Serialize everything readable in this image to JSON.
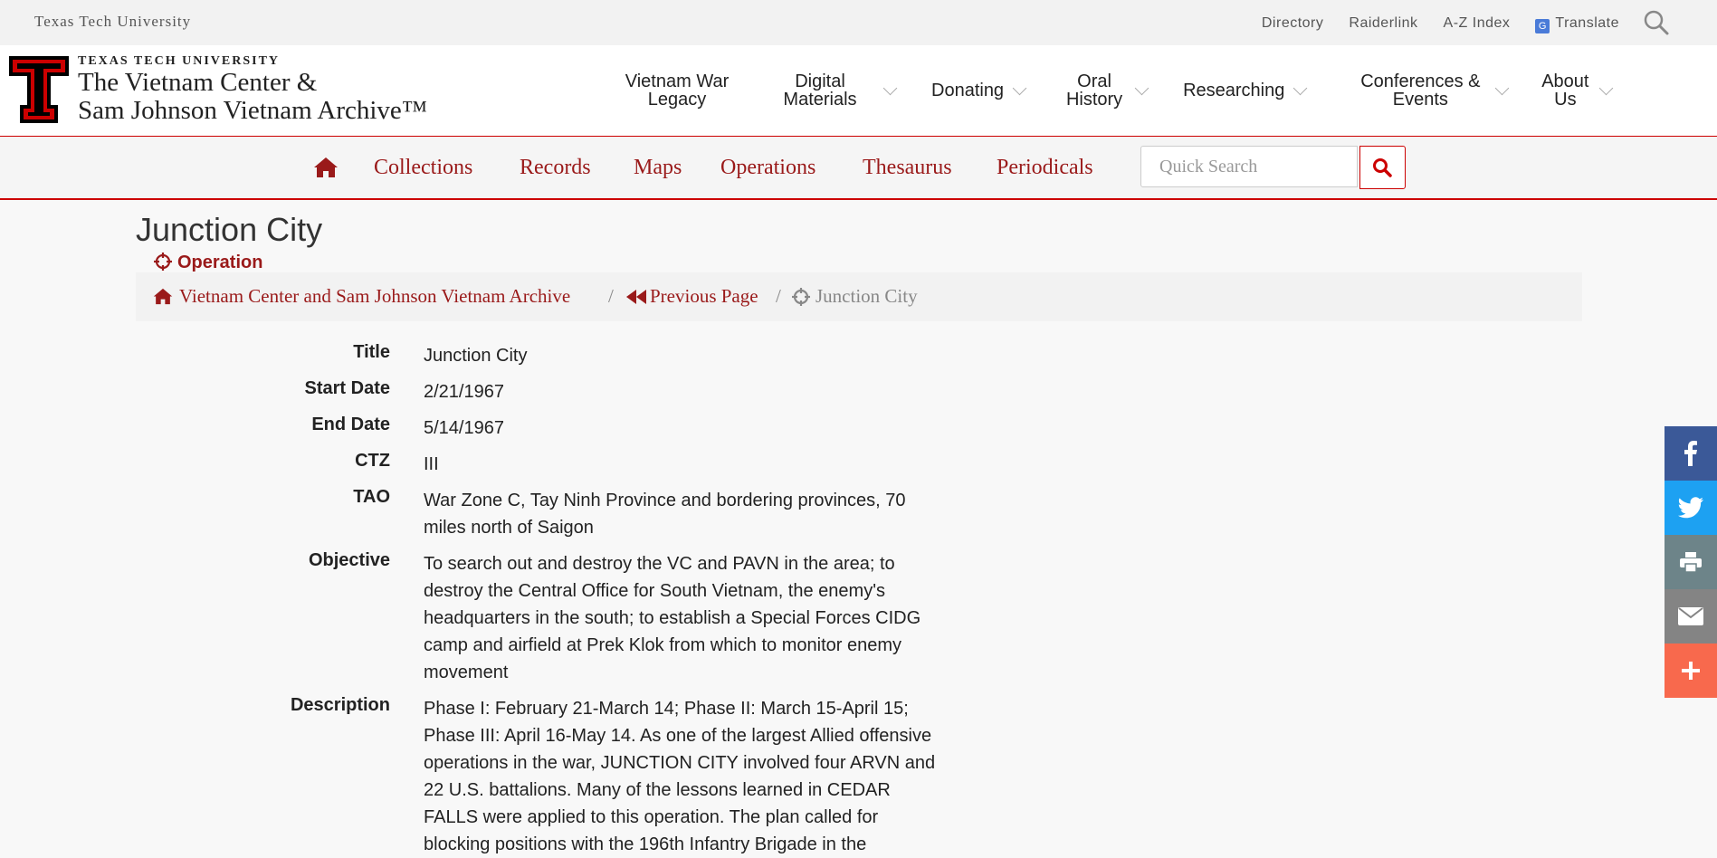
{
  "utility": {
    "university": "Texas Tech University",
    "links": [
      "Directory",
      "Raiderlink",
      "A-Z Index",
      "Translate"
    ]
  },
  "logo": {
    "line1": "TEXAS TECH UNIVERSITY",
    "line2": "The Vietnam Center &",
    "line3": "Sam Johnson Vietnam Archive™"
  },
  "mainnav": [
    {
      "line1": "Vietnam War",
      "line2": "Legacy"
    },
    {
      "line1": "Digital",
      "line2": "Materials"
    },
    {
      "line1": "Donating",
      "line2": ""
    },
    {
      "line1": "Oral",
      "line2": "History"
    },
    {
      "line1": "Researching",
      "line2": ""
    },
    {
      "line1": "Conferences &",
      "line2": "Events"
    },
    {
      "line1": "About",
      "line2": "Us"
    }
  ],
  "subnav": {
    "links": [
      "Collections",
      "Records",
      "Maps",
      "Operations",
      "Thesaurus",
      "Periodicals"
    ],
    "search_placeholder": "Quick Search"
  },
  "page": {
    "title": "Junction City",
    "type": "Operation"
  },
  "breadcrumb": {
    "home": "Vietnam Center and Sam Johnson Vietnam Archive",
    "prev": "Previous Page",
    "current": "Junction City",
    "sep": "/"
  },
  "fields": [
    {
      "label": "Title",
      "value": "Junction City"
    },
    {
      "label": "Start Date",
      "value": "2/21/1967"
    },
    {
      "label": "End Date",
      "value": "5/14/1967"
    },
    {
      "label": "CTZ",
      "value": "III"
    },
    {
      "label": "TAO",
      "value": "War Zone C, Tay Ninh Province and bordering provinces, 70 miles north of Saigon"
    },
    {
      "label": "Objective",
      "value": "To search out and destroy the VC and PAVN in the area; to destroy the Central Office for South Vietnam, the enemy's headquarters in the south; to establish a Special Forces CIDG camp and airfield at Prek Klok from which to monitor enemy movement"
    },
    {
      "label": "Description",
      "value": "Phase I: February 21-March 14; Phase II: March 15-April 15; Phase III: April 16-May 14. As one of the largest Allied offensive operations in the war, JUNCTION CITY involved four ARVN and 22 U.S. battalions. Many of the lessons learned in CEDAR FALLS were applied to this operation. The plan called for blocking positions with the 196th Infantry Brigade in the"
    }
  ],
  "share": [
    "facebook-icon",
    "twitter-icon",
    "print-icon",
    "email-icon",
    "plus-icon"
  ],
  "colors": {
    "accent": "#cc0000",
    "link": "#9a1a1a",
    "facebook": "#3b5998",
    "twitter": "#1da1f2",
    "print": "#6d8489",
    "email": "#848484",
    "more": "#f8694d"
  }
}
